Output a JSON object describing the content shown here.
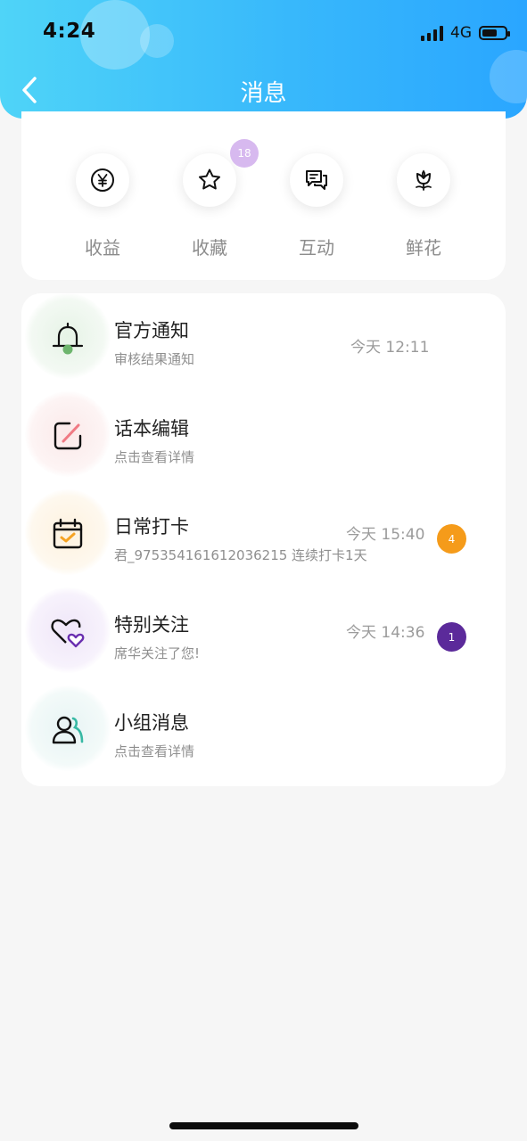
{
  "status_bar": {
    "time": "4:24",
    "network": "4G"
  },
  "header": {
    "title": "消息",
    "back_icon": "chevron-left-icon"
  },
  "categories": [
    {
      "label": "收益",
      "icon": "yen-icon"
    },
    {
      "label": "收藏",
      "icon": "star-icon",
      "badge": "18"
    },
    {
      "label": "互动",
      "icon": "chat-icon"
    },
    {
      "label": "鲜花",
      "icon": "flower-icon"
    }
  ],
  "messages": [
    {
      "title": "官方通知",
      "subtitle": "审核结果通知",
      "time": "今天 12:11",
      "icon": "bell-icon",
      "glow_color": "#eef7ee"
    },
    {
      "title": "话本编辑",
      "subtitle": "点击查看详情",
      "icon": "edit-icon",
      "glow_color": "#fdf1f1"
    },
    {
      "title": "日常打卡",
      "subtitle": "君_975354161612036215 连续打卡1天",
      "time": "今天 15:40",
      "badge": "4",
      "badge_color": "#f59b1a",
      "icon": "calendar-check-icon",
      "glow_color": "#fdf7ec"
    },
    {
      "title": "特别关注",
      "subtitle": "席华关注了您!",
      "time": "今天 14:36",
      "badge": "1",
      "badge_color": "#5b2a9a",
      "icon": "hearts-icon",
      "glow_color": "#f5f0fb"
    },
    {
      "title": "小组消息",
      "subtitle": "点击查看详情",
      "icon": "group-icon",
      "glow_color": "#eff8f8"
    }
  ]
}
